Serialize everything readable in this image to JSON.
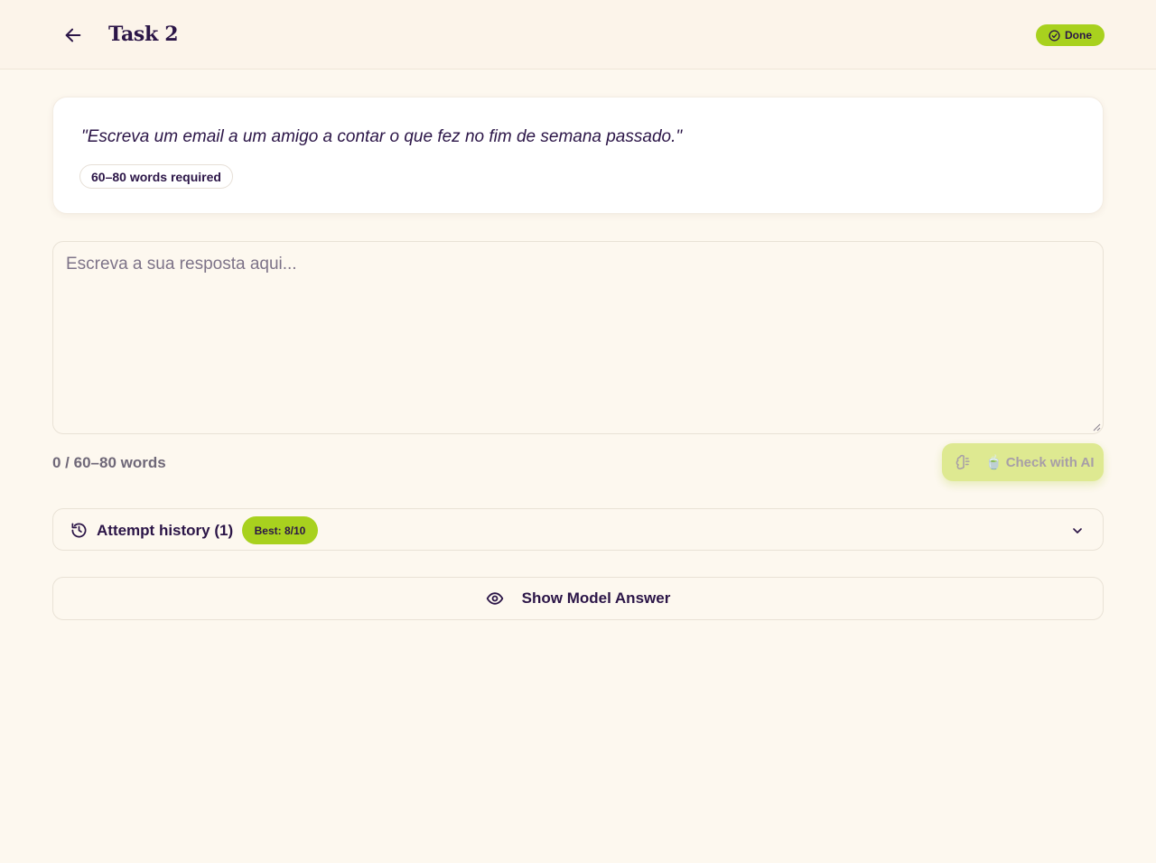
{
  "header": {
    "title": "Task 2",
    "back_icon": "arrow-left-icon",
    "status": {
      "label": "Done",
      "icon": "check-circle-icon",
      "color": "#a8d11e"
    }
  },
  "prompt": {
    "text": "\"Escreva um email a um amigo a contar o que fez no fim de semana passado.\"",
    "requirement": "60–80 words required"
  },
  "answer": {
    "placeholder": "Escreva a sua resposta aqui...",
    "value": ""
  },
  "footer": {
    "word_count": "0 / 60–80 words",
    "check_button": {
      "label": "Check with AI",
      "icon": "brain-icon",
      "emoji": "🍵"
    }
  },
  "history": {
    "label": "Attempt history (1)",
    "icon": "history-icon",
    "best": "Best: 8/10",
    "chevron_icon": "chevron-down-icon"
  },
  "model_answer": {
    "label": "Show Model Answer",
    "icon": "eye-icon"
  },
  "colors": {
    "background": "#fdf8ef",
    "text": "#2b1547",
    "accent": "#a8d11e"
  }
}
